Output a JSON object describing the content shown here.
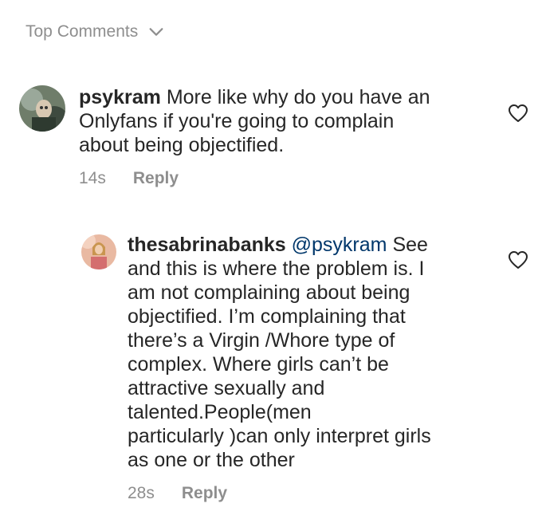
{
  "header": {
    "sort_label": "Top Comments",
    "chevron_icon": "chevron-down-icon"
  },
  "comments": [
    {
      "username": "psykram",
      "mention": "",
      "text_lines": [
        "More like why do you have an",
        "Onlyfans if you're  going to complain",
        "about being objectified."
      ],
      "time": "14s",
      "reply_label": "Reply",
      "like_icon": "heart-outline-icon"
    },
    {
      "username": "thesabrinabanks",
      "mention": "@psykram",
      "text_lines": [
        "See",
        "and this is where the problem is. I",
        "am not complaining about being",
        "objectified. I’m complaining that",
        "there’s a Virgin /Whore type of",
        "complex. Where girls can’t be",
        "attractive sexually and",
        "talented.People(men",
        "particularly )can only interpret girls",
        "as one or the other"
      ],
      "time": "28s",
      "reply_label": "Reply",
      "like_icon": "heart-outline-icon"
    }
  ],
  "colors": {
    "text": "#262626",
    "secondary": "#8e8e8e",
    "mention": "#00376b"
  }
}
